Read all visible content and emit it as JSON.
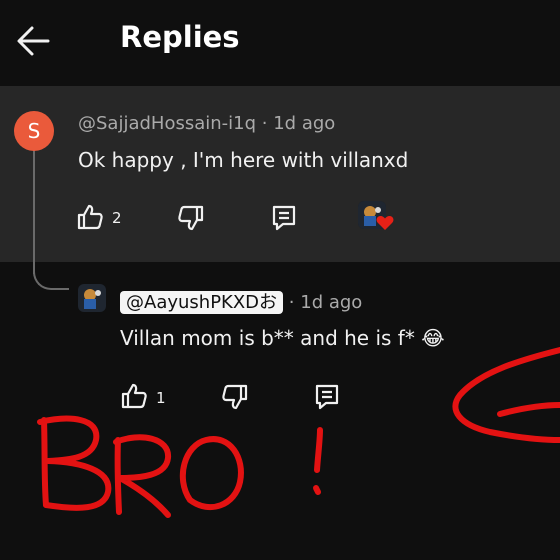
{
  "header": {
    "title": "Replies"
  },
  "top_comment": {
    "avatar_letter": "S",
    "author": "@SajjadHossain-i1q",
    "separator": "·",
    "time": "1d ago",
    "text": "Ok happy , I'm here with villanxd",
    "like_count": "2",
    "avatar_color": "#ea5a3b"
  },
  "reply": {
    "mention": "@AayushPKXDお",
    "separator": "·",
    "time": "1d ago",
    "text": "Villan mom is b** and he is f* 😂",
    "like_count": "1"
  },
  "annotation": {
    "handwritten": "BRO !"
  },
  "colors": {
    "background": "#0f0f0f",
    "highlight": "#272727",
    "scribble": "#e31212"
  },
  "icons": [
    "back-arrow-icon",
    "thumb-up-icon",
    "thumb-down-icon",
    "reply-icon"
  ]
}
